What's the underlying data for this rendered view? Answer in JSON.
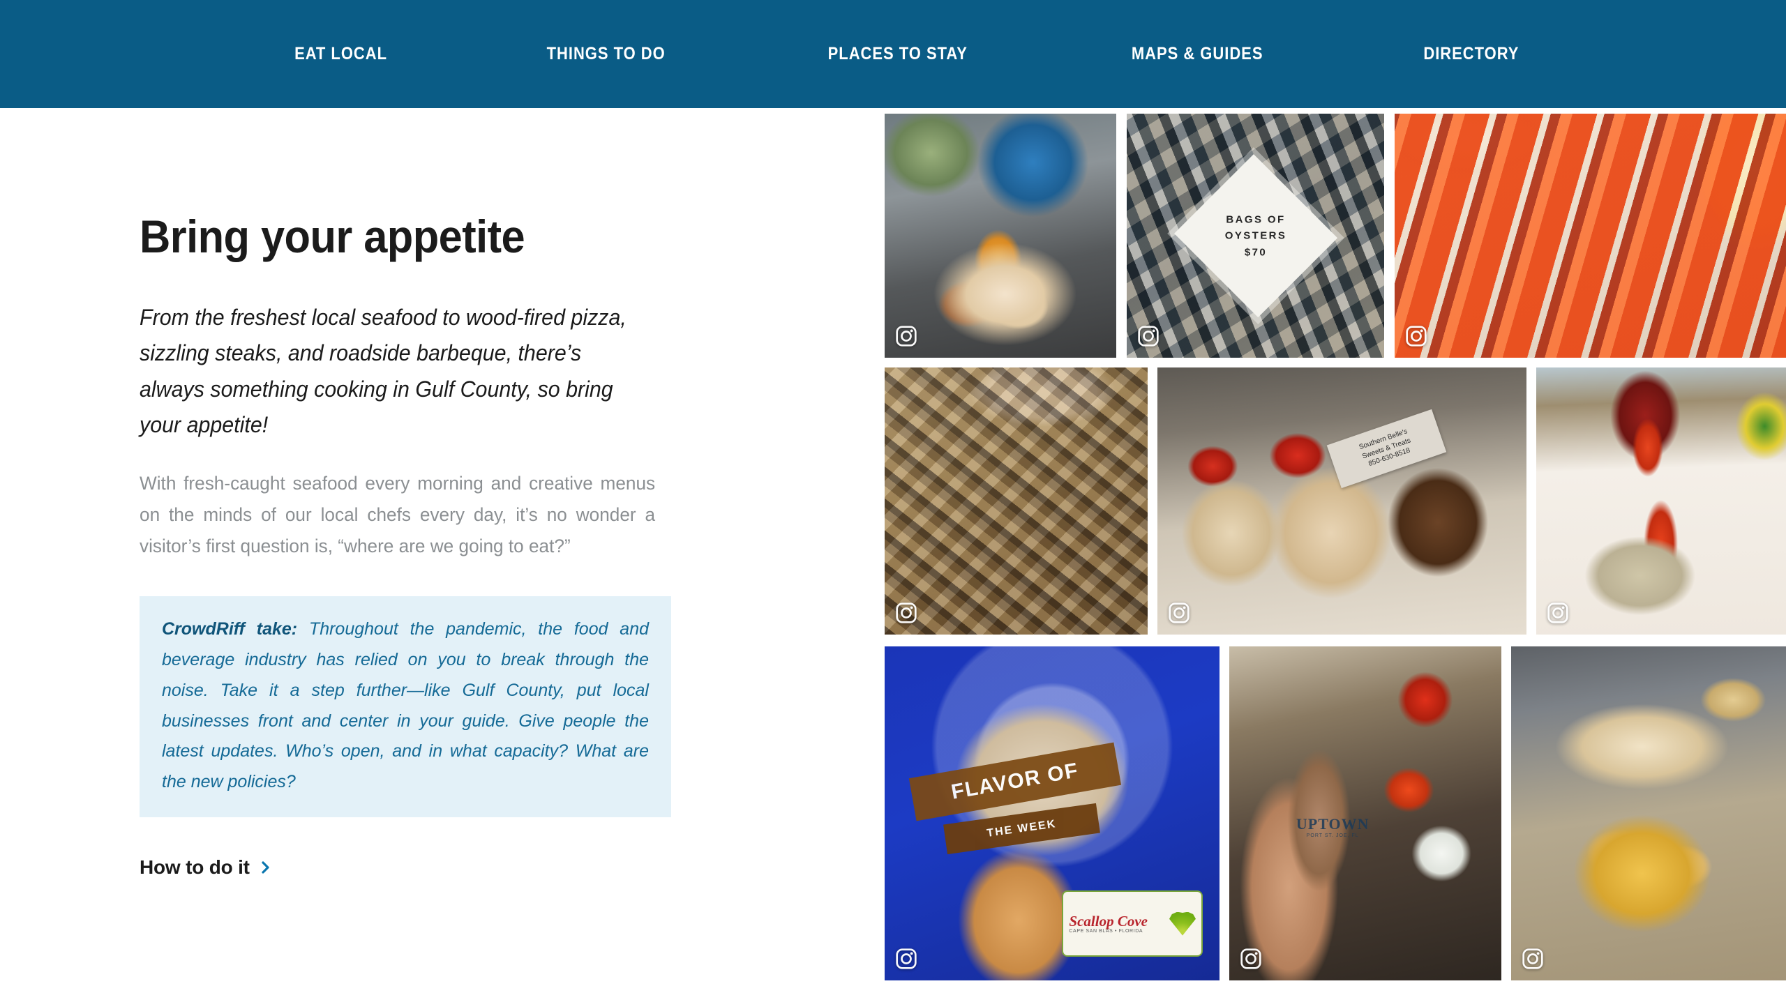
{
  "colors": {
    "nav_bg": "#0a5c86",
    "accent_link": "#0a76ae",
    "callout_bg": "#e3f1f8",
    "callout_text": "#156a96",
    "body_text": "#8b8f92",
    "heading": "#1b1b1b"
  },
  "nav": {
    "items": [
      {
        "label": "EAT LOCAL",
        "name": "nav-item-eat-local"
      },
      {
        "label": "THINGS TO DO",
        "name": "nav-item-things-to-do"
      },
      {
        "label": "PLACES TO STAY",
        "name": "nav-item-places-to-stay"
      },
      {
        "label": "MAPS & GUIDES",
        "name": "nav-item-maps-guides"
      },
      {
        "label": "DIRECTORY",
        "name": "nav-item-directory"
      }
    ]
  },
  "content": {
    "title": "Bring your appetite",
    "lead": "From the freshest local seafood to wood-fired pizza, sizzling steaks, and roadside barbeque, there’s always something cooking in Gulf County, so bring your appetite!",
    "body": "With fresh-caught seafood every morning and creative menus on the minds of our local chefs every day, it’s no wonder a visitor’s first question is, “where are we going to eat?”",
    "callout": {
      "label": "CrowdRiff take:",
      "text": " Throughout the pandemic, the food and beverage industry has relied on you to break through the noise. Take it a step further—like Gulf County, put local businesses front and center in your guide. Give people the latest updates. Who’s open, and in what capacity? What are the new policies?"
    },
    "cta": {
      "label": "How to do it",
      "icon": "chevron-right-icon"
    }
  },
  "gallery": {
    "badge_icon": "instagram-icon",
    "tiles": [
      {
        "name": "gallery-tile-scallops",
        "alt": "Pan-seared scallops on a white plate with crispy shoestring garnish",
        "overlay_text": ""
      },
      {
        "name": "gallery-tile-oysters",
        "alt": "Tray of raw oysters on the half shell",
        "overlay_text": "BAGS OF\nOYSTERS\n$70"
      },
      {
        "name": "gallery-tile-crab-legs",
        "alt": "Platter of red snow crab legs with lemon wedges",
        "overlay_text": ""
      },
      {
        "name": "gallery-tile-grilled-fish",
        "alt": "Grilled whole fish on foil on a granite counter",
        "overlay_text": ""
      },
      {
        "name": "gallery-tile-desserts",
        "alt": "Three stuffed dessert apples with strawberries and drizzle",
        "overlay_text": "Southern Belle's\nSweets & Treats\n850-630-8518"
      },
      {
        "name": "gallery-tile-table-setting",
        "alt": "Restaurant table set with red folded napkins and menu cards",
        "overlay_text": ""
      },
      {
        "name": "gallery-tile-ice-cream",
        "alt": "Ice cream cone in front of a Scallop Cove sign",
        "overlay_text": "FLAVOR OF",
        "overlay_text_2": "THE WEEK",
        "logo_name": "Scallop Cove",
        "logo_sub": "CAPE SAN BLAS • FLORIDA"
      },
      {
        "name": "gallery-tile-drink",
        "alt": "Hand holding an Uptown Raw Bar tumbler with a frozen drink",
        "overlay_text": "UPTOWN",
        "overlay_sub": "PORT ST. JOE, FL"
      },
      {
        "name": "gallery-tile-baked-oysters",
        "alt": "Platters of baked oysters and shrimp with garlic bread",
        "overlay_text": ""
      }
    ]
  }
}
